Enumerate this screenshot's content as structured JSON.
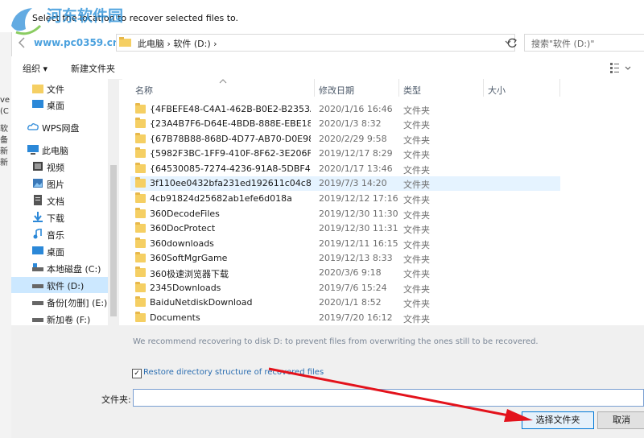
{
  "window": {
    "title": "Select the location to recover selected files to."
  },
  "watermark": {
    "line1": "河东软件园",
    "line2": "www.pc0359.cn"
  },
  "background_window": {
    "fragments": [
      "ve",
      "(C",
      "软",
      "备",
      "新",
      "新"
    ]
  },
  "address": {
    "path": "此电脑  ›  软件 (D:)  ›"
  },
  "search": {
    "placeholder": "搜索\"软件 (D:)\""
  },
  "toolbar": {
    "organize": "组织 ▾",
    "new_folder": "新建文件夹"
  },
  "nav": {
    "items": [
      {
        "label": "文件",
        "icon": "folder-icon"
      },
      {
        "label": "桌面",
        "icon": "desktop-icon"
      },
      {
        "label": "WPS网盘",
        "icon": "cloud-icon"
      },
      {
        "label": "此电脑",
        "icon": "computer-icon"
      },
      {
        "label": "视频",
        "icon": "video-icon"
      },
      {
        "label": "图片",
        "icon": "picture-icon"
      },
      {
        "label": "文档",
        "icon": "document-icon"
      },
      {
        "label": "下载",
        "icon": "download-icon"
      },
      {
        "label": "音乐",
        "icon": "music-icon"
      },
      {
        "label": "桌面",
        "icon": "desktop-icon"
      },
      {
        "label": "本地磁盘 (C:)",
        "icon": "drive-icon"
      },
      {
        "label": "软件 (D:)",
        "icon": "drive-icon"
      },
      {
        "label": "备份[勿删] (E:)",
        "icon": "drive-icon"
      },
      {
        "label": "新加卷 (F:)",
        "icon": "drive-icon"
      }
    ]
  },
  "columns": {
    "name": "名称",
    "date": "修改日期",
    "type": "类型",
    "size": "大小"
  },
  "files": [
    {
      "name": "{4FBEFE48-C4A1-462B-B0E2-B2353A3...",
      "date": "2020/1/16 16:46",
      "type": "文件夹"
    },
    {
      "name": "{23A4B7F6-D64E-4BDB-888E-EBE188...",
      "date": "2020/1/3 8:32",
      "type": "文件夹"
    },
    {
      "name": "{67B78B88-868D-4D77-AB70-D0E988...",
      "date": "2020/2/29 9:58",
      "type": "文件夹"
    },
    {
      "name": "{5982F3BC-1FF9-410F-8F62-3E206FAF...",
      "date": "2019/12/17 8:29",
      "type": "文件夹"
    },
    {
      "name": "{64530085-7274-4236-91A8-5DBF484...",
      "date": "2020/1/17 13:46",
      "type": "文件夹"
    },
    {
      "name": "3f110ee0432bfa231ed192611c04c882",
      "date": "2019/7/3 14:20",
      "type": "文件夹"
    },
    {
      "name": "4cb91824d25682ab1efe6d018a",
      "date": "2019/12/12 17:16",
      "type": "文件夹"
    },
    {
      "name": "360DecodeFiles",
      "date": "2019/12/30 11:30",
      "type": "文件夹"
    },
    {
      "name": "360DocProtect",
      "date": "2019/12/30 11:31",
      "type": "文件夹"
    },
    {
      "name": "360downloads",
      "date": "2019/12/11 16:15",
      "type": "文件夹"
    },
    {
      "name": "360SoftMgrGame",
      "date": "2019/12/13 8:33",
      "type": "文件夹"
    },
    {
      "name": "360极速浏览器下载",
      "date": "2020/3/6 9:18",
      "type": "文件夹"
    },
    {
      "name": "2345Downloads",
      "date": "2019/7/6 15:24",
      "type": "文件夹"
    },
    {
      "name": "BaiduNetdiskDownload",
      "date": "2020/1/1 8:52",
      "type": "文件夹"
    },
    {
      "name": "Documents",
      "date": "2019/7/20 16:12",
      "type": "文件夹"
    }
  ],
  "bottom": {
    "recommend": "We recommend recovering to disk D: to prevent files from overwriting the ones still to be recovered.",
    "restore_label": "Restore directory structure of recovered files",
    "restore_mark": "✓",
    "folder_label": "文件夹:",
    "folder_value": "",
    "select_button": "选择文件夹",
    "cancel_button": "取消"
  }
}
